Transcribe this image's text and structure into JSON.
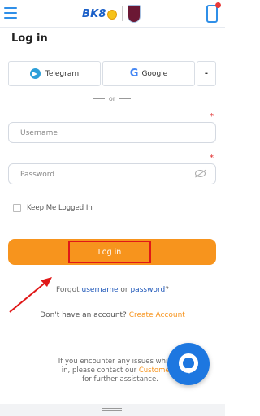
{
  "header": {
    "logo_text": "BK8",
    "icons": [
      "menu-icon",
      "bk8-logo",
      "club-crest",
      "app-download-icon"
    ]
  },
  "page": {
    "title": "Log in"
  },
  "social": {
    "telegram_label": "Telegram",
    "google_label": "Google",
    "more_label": "-"
  },
  "divider": {
    "or_label": "or"
  },
  "form": {
    "required_mark": "*",
    "username_placeholder": "Username",
    "password_placeholder": "Password",
    "remember_label": "Keep Me Logged In",
    "login_label": "Log in"
  },
  "links": {
    "forgot_prefix": "Forgot ",
    "username_link": "username",
    "or_text": " or ",
    "password_link": "password",
    "forgot_suffix": "?",
    "no_account": "Don't have an account? ",
    "create_account": "Create Account"
  },
  "support": {
    "line_prefix": "If you encounter any issues while lo",
    "line_mid": "in, please contact our ",
    "customer_link": "Customer S",
    "line_end": "for further assistance."
  },
  "colors": {
    "accent": "#f7941d",
    "link": "#1c55b8",
    "chat": "#1d77e0",
    "highlight": "#e01818"
  }
}
